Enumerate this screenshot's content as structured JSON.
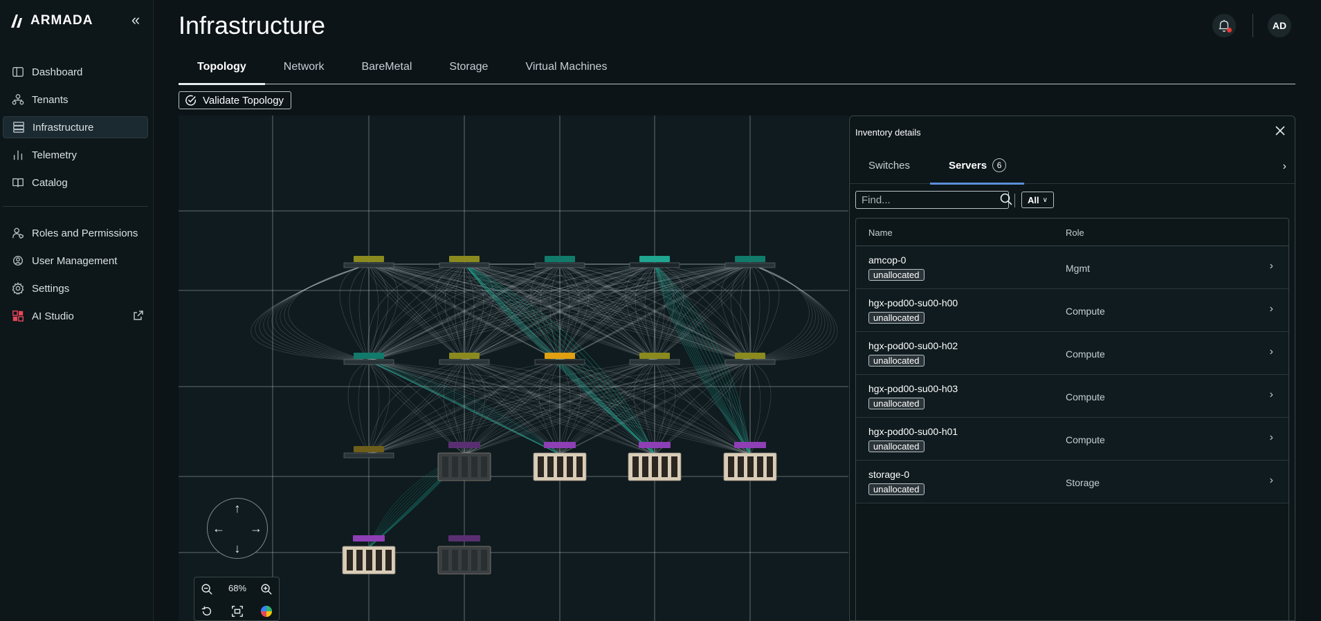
{
  "app": {
    "brand": "ARMADA",
    "page_title": "Infrastructure",
    "user_initials": "AD"
  },
  "sidebar": {
    "items": [
      {
        "label": "Dashboard",
        "icon": "dashboard-icon"
      },
      {
        "label": "Tenants",
        "icon": "tenants-icon"
      },
      {
        "label": "Infrastructure",
        "icon": "infrastructure-icon",
        "active": true
      },
      {
        "label": "Telemetry",
        "icon": "telemetry-icon"
      },
      {
        "label": "Catalog",
        "icon": "catalog-icon"
      }
    ],
    "items2": [
      {
        "label": "Roles and Permissions",
        "icon": "roles-icon"
      },
      {
        "label": "User Management",
        "icon": "user-management-icon"
      },
      {
        "label": "Settings",
        "icon": "gear-icon"
      },
      {
        "label": "AI Studio",
        "icon": "ai-studio-icon"
      }
    ]
  },
  "tabs": [
    {
      "label": "Topology",
      "active": true
    },
    {
      "label": "Network"
    },
    {
      "label": "BareMetal"
    },
    {
      "label": "Storage"
    },
    {
      "label": "Virtual Machines"
    }
  ],
  "toolbar": {
    "validate_label": "Validate Topology"
  },
  "zoom": {
    "level": "68%"
  },
  "inventory": {
    "title": "Inventory details",
    "tabs": [
      {
        "label": "Switches"
      },
      {
        "label": "Servers",
        "count": "6",
        "active": true
      }
    ],
    "search_placeholder": "Find...",
    "filter_value": "All",
    "columns": {
      "name": "Name",
      "role": "Role"
    },
    "rows": [
      {
        "name": "amcop-0",
        "status": "unallocated",
        "role": "Mgmt"
      },
      {
        "name": "hgx-pod00-su00-h00",
        "status": "unallocated",
        "role": "Compute"
      },
      {
        "name": "hgx-pod00-su00-h02",
        "status": "unallocated",
        "role": "Compute"
      },
      {
        "name": "hgx-pod00-su00-h03",
        "status": "unallocated",
        "role": "Compute"
      },
      {
        "name": "hgx-pod00-su00-h01",
        "status": "unallocated",
        "role": "Compute"
      },
      {
        "name": "storage-0",
        "status": "unallocated",
        "role": "Storage"
      }
    ]
  },
  "colors": {
    "accent_teal": "#1fa590",
    "accent_blue": "#5b8fd9",
    "node_yellow": "#c9b227",
    "node_purple": "#8e3fb5"
  }
}
